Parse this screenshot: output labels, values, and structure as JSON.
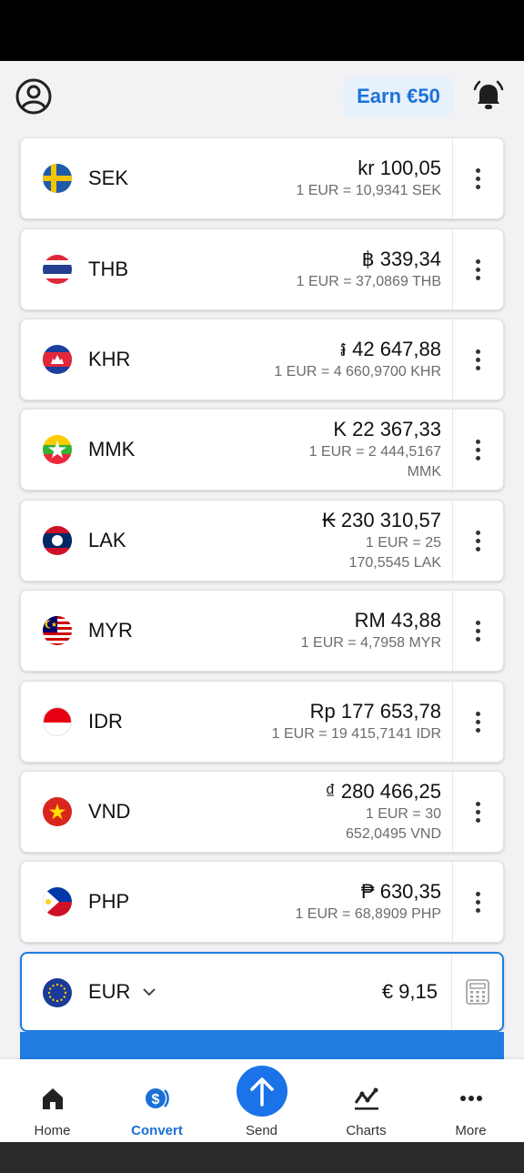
{
  "header": {
    "earn_label": "Earn €50"
  },
  "currencies": [
    {
      "code": "SEK",
      "amount": "kr 100,05",
      "rate": "1 EUR = 10,9341 SEK"
    },
    {
      "code": "THB",
      "amount": "฿ 339,34",
      "rate": "1 EUR = 37,0869 THB"
    },
    {
      "code": "KHR",
      "amount": "៛ 42 647,88",
      "rate": "1 EUR = 4 660,9700 KHR"
    },
    {
      "code": "MMK",
      "amount": "K 22 367,33",
      "rate": "1 EUR = 2 444,5167 MMK"
    },
    {
      "code": "LAK",
      "amount": "₭ 230 310,57",
      "rate": "1 EUR = 25 170,5545 LAK"
    },
    {
      "code": "MYR",
      "amount": "RM 43,88",
      "rate": "1 EUR = 4,7958 MYR"
    },
    {
      "code": "IDR",
      "amount": "Rp 177 653,78",
      "rate": "1 EUR = 19 415,7141 IDR"
    },
    {
      "code": "VND",
      "amount": "₫ 280 466,25",
      "rate": "1 EUR = 30 652,0495 VND"
    },
    {
      "code": "PHP",
      "amount": "₱ 630,35",
      "rate": "1 EUR = 68,8909 PHP"
    }
  ],
  "base": {
    "code": "EUR",
    "amount": "€ 9,15"
  },
  "nav": {
    "home": "Home",
    "convert": "Convert",
    "send": "Send",
    "charts": "Charts",
    "more": "More"
  },
  "colors": {
    "accent": "#1f7de2",
    "earn_bg": "#e7f1fc"
  }
}
